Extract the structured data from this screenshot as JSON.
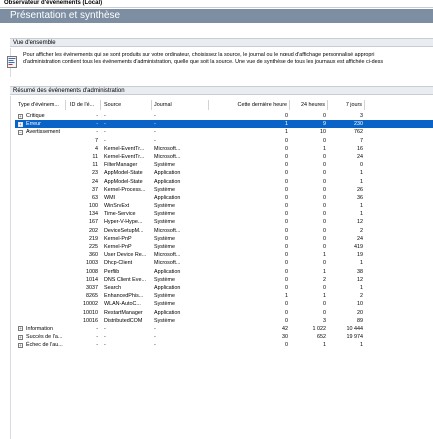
{
  "window": {
    "title": "Observateur d'événements (Local)"
  },
  "banner": {
    "heading": "Présentation et synthèse"
  },
  "overview": {
    "header": "Vue d'ensemble",
    "icon": "event-viewer-icon",
    "line1": "Pour afficher les événements qui se sont produits sur votre ordinateur, choisissez la source, le journal ou le nœud d'affichage personnalisé appropri",
    "line2": "d'administration contient tous les événements d'administration, quelle que soit la source. Une vue de synthèse de tous les journaux est affichée ci-dess"
  },
  "summary": {
    "header": "Résumé des événements d'administration",
    "columns": {
      "type": "Type d'événem...",
      "id": "ID de l'é...",
      "source": "Source",
      "journal": "Journal",
      "last_hour": "Cette dernière heure",
      "last_24h": "24 heures",
      "last_7d": "7 jours"
    },
    "rows": [
      {
        "kind": "group",
        "expander": "+",
        "type": "Critique",
        "id": "-",
        "source": "-",
        "journal": "-",
        "last_hour": "0",
        "last_24h": "0",
        "last_7d": "3",
        "selected": false
      },
      {
        "kind": "group",
        "expander": "+",
        "type": "Erreur",
        "id": "-",
        "source": "-",
        "journal": "-",
        "last_hour": "1",
        "last_24h": "9",
        "last_7d": "230",
        "selected": true
      },
      {
        "kind": "group",
        "expander": "−",
        "type": "Avertissement",
        "id": "-",
        "source": "-",
        "journal": "-",
        "last_hour": "1",
        "last_24h": "10",
        "last_7d": "762",
        "selected": false
      },
      {
        "kind": "item",
        "expander": "",
        "type": "",
        "id": "7",
        "source": "-",
        "journal": "-",
        "last_hour": "0",
        "last_24h": "0",
        "last_7d": "7",
        "selected": false
      },
      {
        "kind": "item",
        "expander": "",
        "type": "",
        "id": "4",
        "source": "Kernel-EventTr...",
        "journal": "Microsoft...",
        "last_hour": "0",
        "last_24h": "1",
        "last_7d": "16",
        "selected": false
      },
      {
        "kind": "item",
        "expander": "",
        "type": "",
        "id": "11",
        "source": "Kernel-EventTr...",
        "journal": "Microsoft...",
        "last_hour": "0",
        "last_24h": "0",
        "last_7d": "24",
        "selected": false
      },
      {
        "kind": "item",
        "expander": "",
        "type": "",
        "id": "11",
        "source": "FilterManager",
        "journal": "Système",
        "last_hour": "0",
        "last_24h": "0",
        "last_7d": "0",
        "selected": false
      },
      {
        "kind": "item",
        "expander": "",
        "type": "",
        "id": "23",
        "source": "AppModel-State",
        "journal": "Application",
        "last_hour": "0",
        "last_24h": "0",
        "last_7d": "1",
        "selected": false
      },
      {
        "kind": "item",
        "expander": "",
        "type": "",
        "id": "24",
        "source": "AppModel-State",
        "journal": "Application",
        "last_hour": "0",
        "last_24h": "0",
        "last_7d": "1",
        "selected": false
      },
      {
        "kind": "item",
        "expander": "",
        "type": "",
        "id": "37",
        "source": "Kernel-Process...",
        "journal": "Système",
        "last_hour": "0",
        "last_24h": "0",
        "last_7d": "26",
        "selected": false
      },
      {
        "kind": "item",
        "expander": "",
        "type": "",
        "id": "63",
        "source": "WMI",
        "journal": "Application",
        "last_hour": "0",
        "last_24h": "0",
        "last_7d": "36",
        "selected": false
      },
      {
        "kind": "item",
        "expander": "",
        "type": "",
        "id": "100",
        "source": "WinSrvExt",
        "journal": "Système",
        "last_hour": "0",
        "last_24h": "0",
        "last_7d": "1",
        "selected": false
      },
      {
        "kind": "item",
        "expander": "",
        "type": "",
        "id": "134",
        "source": "Time-Service",
        "journal": "Système",
        "last_hour": "0",
        "last_24h": "0",
        "last_7d": "1",
        "selected": false
      },
      {
        "kind": "item",
        "expander": "",
        "type": "",
        "id": "167",
        "source": "Hyper-V-Hype...",
        "journal": "Système",
        "last_hour": "0",
        "last_24h": "0",
        "last_7d": "12",
        "selected": false
      },
      {
        "kind": "item",
        "expander": "",
        "type": "",
        "id": "202",
        "source": "DeviceSetupM...",
        "journal": "Microsoft...",
        "last_hour": "0",
        "last_24h": "0",
        "last_7d": "2",
        "selected": false
      },
      {
        "kind": "item",
        "expander": "",
        "type": "",
        "id": "219",
        "source": "Kernel-PnP",
        "journal": "Système",
        "last_hour": "0",
        "last_24h": "0",
        "last_7d": "24",
        "selected": false
      },
      {
        "kind": "item",
        "expander": "",
        "type": "",
        "id": "225",
        "source": "Kernel-PnP",
        "journal": "Système",
        "last_hour": "0",
        "last_24h": "0",
        "last_7d": "419",
        "selected": false
      },
      {
        "kind": "item",
        "expander": "",
        "type": "",
        "id": "360",
        "source": "User Device Re...",
        "journal": "Microsoft...",
        "last_hour": "0",
        "last_24h": "1",
        "last_7d": "19",
        "selected": false
      },
      {
        "kind": "item",
        "expander": "",
        "type": "",
        "id": "1003",
        "source": "Dhcp-Client",
        "journal": "Microsoft...",
        "last_hour": "0",
        "last_24h": "0",
        "last_7d": "1",
        "selected": false
      },
      {
        "kind": "item",
        "expander": "",
        "type": "",
        "id": "1008",
        "source": "Perflib",
        "journal": "Application",
        "last_hour": "0",
        "last_24h": "1",
        "last_7d": "38",
        "selected": false
      },
      {
        "kind": "item",
        "expander": "",
        "type": "",
        "id": "1014",
        "source": "DNS Client Eve...",
        "journal": "Système",
        "last_hour": "0",
        "last_24h": "2",
        "last_7d": "12",
        "selected": false
      },
      {
        "kind": "item",
        "expander": "",
        "type": "",
        "id": "3037",
        "source": "Search",
        "journal": "Application",
        "last_hour": "0",
        "last_24h": "0",
        "last_7d": "1",
        "selected": false
      },
      {
        "kind": "item",
        "expander": "",
        "type": "",
        "id": "8265",
        "source": "EnhancedPhis...",
        "journal": "Système",
        "last_hour": "1",
        "last_24h": "1",
        "last_7d": "2",
        "selected": false
      },
      {
        "kind": "item",
        "expander": "",
        "type": "",
        "id": "10002",
        "source": "WLAN-AutoC...",
        "journal": "Système",
        "last_hour": "0",
        "last_24h": "0",
        "last_7d": "10",
        "selected": false
      },
      {
        "kind": "item",
        "expander": "",
        "type": "",
        "id": "10010",
        "source": "RestartManager",
        "journal": "Application",
        "last_hour": "0",
        "last_24h": "0",
        "last_7d": "20",
        "selected": false
      },
      {
        "kind": "item",
        "expander": "",
        "type": "",
        "id": "10016",
        "source": "DistributedCOM",
        "journal": "Système",
        "last_hour": "0",
        "last_24h": "3",
        "last_7d": "89",
        "selected": false
      },
      {
        "kind": "group",
        "expander": "+",
        "type": "Information",
        "id": "-",
        "source": "-",
        "journal": "-",
        "last_hour": "42",
        "last_24h": "1 022",
        "last_7d": "10 444",
        "selected": false
      },
      {
        "kind": "group",
        "expander": "+",
        "type": "Succès de l'a...",
        "id": "-",
        "source": "-",
        "journal": "-",
        "last_hour": "30",
        "last_24h": "652",
        "last_7d": "19 974",
        "selected": false
      },
      {
        "kind": "group",
        "expander": "+",
        "type": "Échec de l'au...",
        "id": "-",
        "source": "-",
        "journal": "-",
        "last_hour": "0",
        "last_24h": "1",
        "last_7d": "1",
        "selected": false
      }
    ]
  },
  "colors": {
    "banner": "#7d8ea3",
    "section_header": "#e9ecf0",
    "selection": "#0a64c8"
  }
}
